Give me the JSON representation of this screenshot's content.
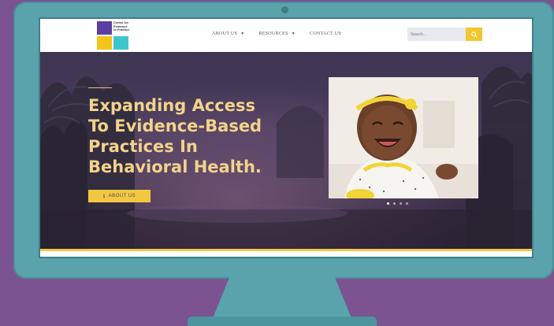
{
  "logo": {
    "text_lines": [
      "Center for",
      "Evidence",
      "to Practice"
    ]
  },
  "nav": {
    "items": [
      {
        "label": "ABOUT US",
        "has_dropdown": true
      },
      {
        "label": "RESOURCES",
        "has_dropdown": true
      },
      {
        "label": "CONTACT US",
        "has_dropdown": false
      }
    ]
  },
  "search": {
    "placeholder": "Search..."
  },
  "hero": {
    "title_lines": [
      "Expanding Access",
      "To Evidence-Based",
      "Practices In",
      "Behavioral Health."
    ],
    "button_label": "ABOUT US",
    "slider_dots": 4,
    "active_slide": 1
  },
  "colors": {
    "background": "#7b5391",
    "monitor": "#5aa2ac",
    "accent_yellow": "#f1c840",
    "title_gold": "#f2d38a",
    "logo_purple": "#5b3fa0",
    "logo_teal": "#3ec6cf"
  },
  "icons": {
    "nav_caret": "chevron-down-icon",
    "search": "search-icon",
    "button": "info-icon"
  }
}
